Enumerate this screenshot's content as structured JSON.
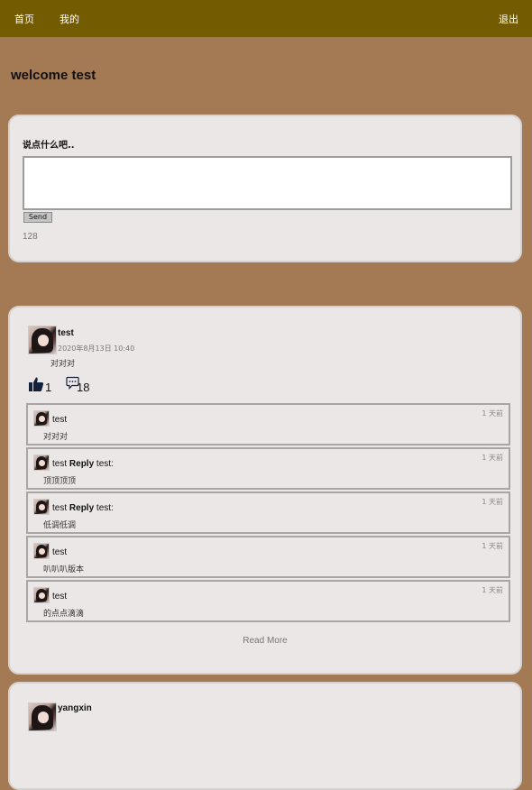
{
  "nav": {
    "home": "首页",
    "mine": "我的",
    "logout": "退出"
  },
  "welcome": "welcome test",
  "compose": {
    "prompt": "说点什么吧..",
    "textarea_value": "",
    "send_label": "Send",
    "char_count": "128"
  },
  "posts": [
    {
      "author": "test",
      "time": "2020年8月13日 10:40",
      "text": "对对对",
      "likes": "1",
      "comments": "18",
      "comment_list": [
        {
          "author": "test",
          "reply_label": "",
          "reply_to": "",
          "text": "对对对",
          "time": "1 天前"
        },
        {
          "author": "test",
          "reply_label": "Reply",
          "reply_to": "test:",
          "text": "顶顶顶顶",
          "time": "1 天前"
        },
        {
          "author": "test",
          "reply_label": "Reply",
          "reply_to": "test:",
          "text": "低调低调",
          "time": "1 天前"
        },
        {
          "author": "test",
          "reply_label": "",
          "reply_to": "",
          "text": "叭叭叭版本",
          "time": "1 天前"
        },
        {
          "author": "test",
          "reply_label": "",
          "reply_to": "",
          "text": "的点点滴滴",
          "time": "1 天前"
        }
      ],
      "read_more": "Read More"
    },
    {
      "author": "yangxin"
    }
  ],
  "colors": {
    "topbar": "#735b02",
    "page_bg": "#a47a55",
    "card_bg": "#ebe7e7"
  },
  "icons": {
    "like": "thumbs-up-icon",
    "comment": "comment-bubble-icon"
  }
}
